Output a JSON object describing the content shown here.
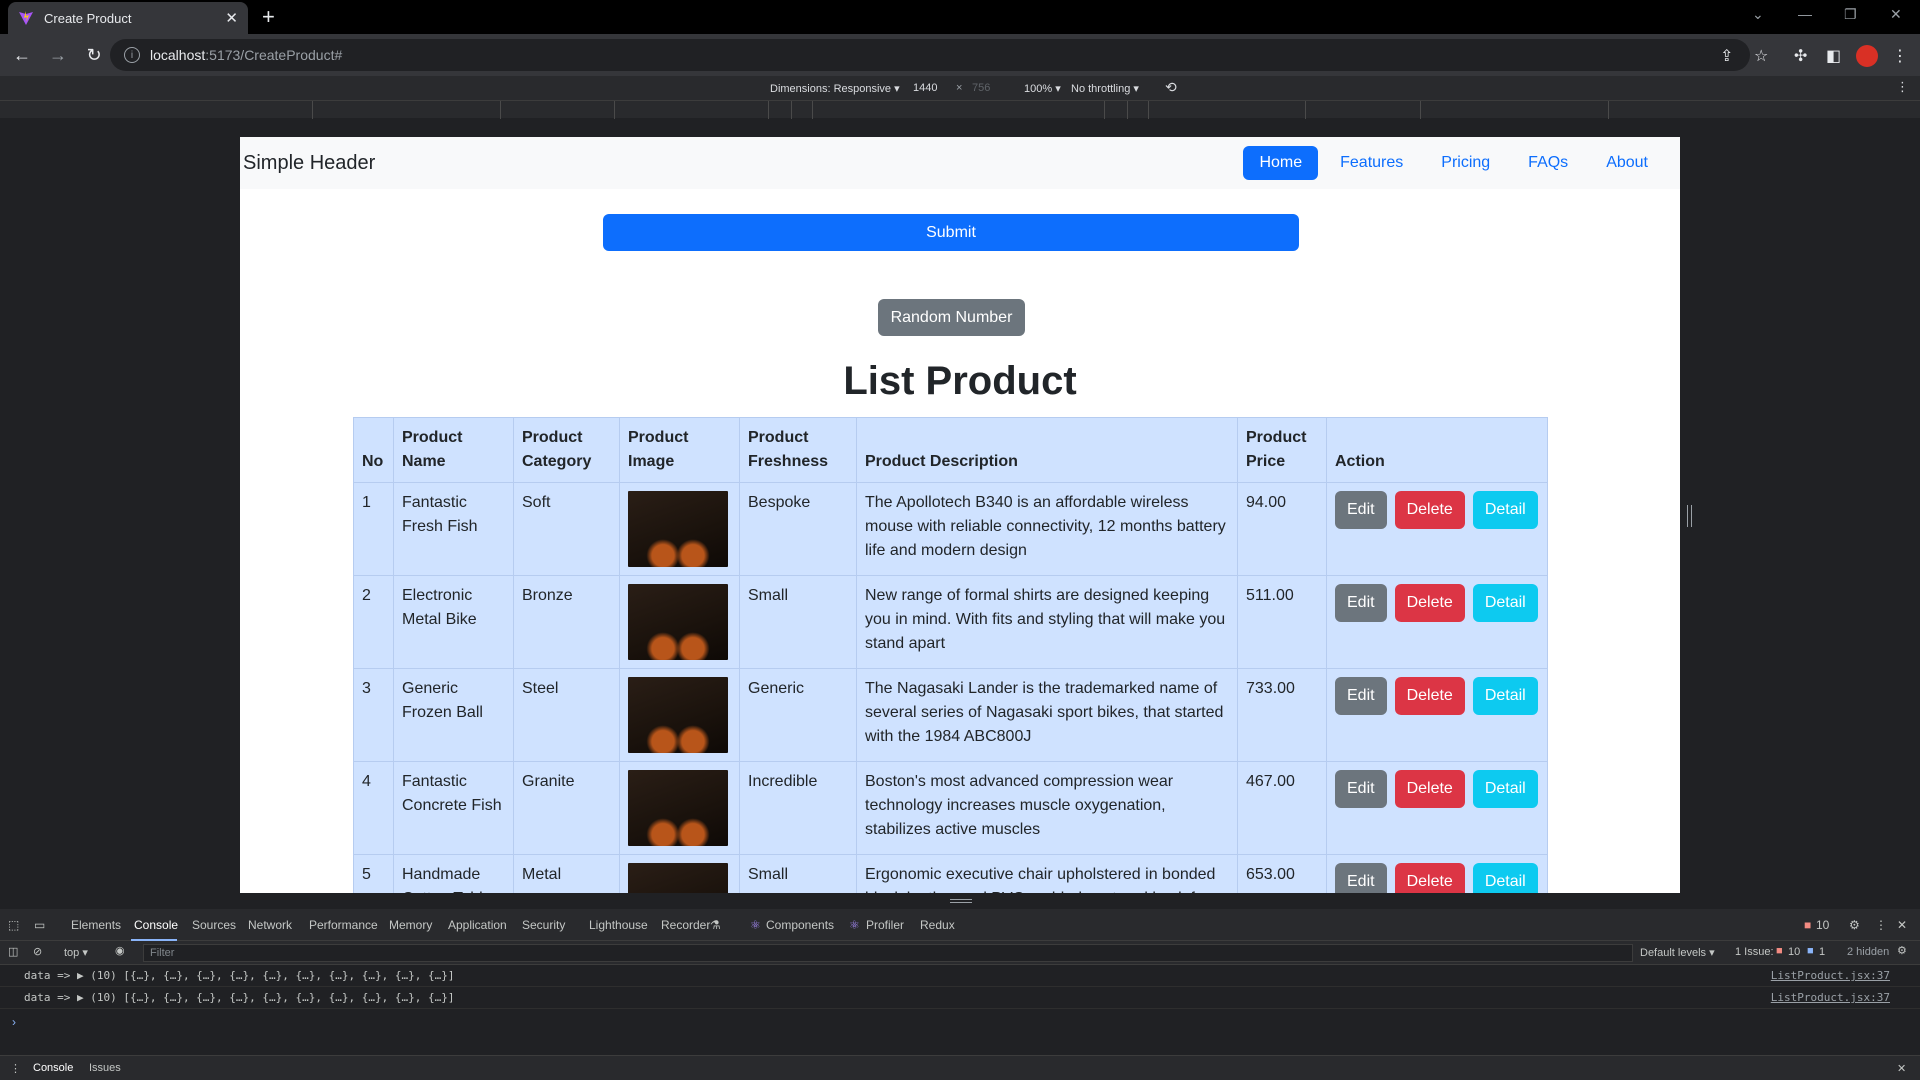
{
  "browser": {
    "tab_title": "Create Product",
    "url_host": "localhost",
    "url_path": ":5173/CreateProduct#"
  },
  "devbar": {
    "dimensions": "Dimensions: Responsive ▾",
    "width": "1440",
    "times": "×",
    "height": "756",
    "zoom": "100% ▾",
    "throttling": "No throttling ▾"
  },
  "header": {
    "brand": "Simple Header",
    "nav": [
      "Home",
      "Features",
      "Pricing",
      "FAQs",
      "About"
    ]
  },
  "buttons": {
    "submit": "Submit",
    "random": "Random Number"
  },
  "list": {
    "title": "List Product",
    "columns": [
      "No",
      "Product Name",
      "Product Category",
      "Product Image",
      "Product Freshness",
      "Product Description",
      "Product Price",
      "Action"
    ],
    "rows": [
      {
        "no": "1",
        "name": "Fantastic Fresh Fish",
        "category": "Soft",
        "freshness": "Bespoke",
        "description": "The Apollotech B340 is an affordable wireless mouse with reliable connectivity, 12 months battery life and modern design",
        "price": "94.00"
      },
      {
        "no": "2",
        "name": "Electronic Metal Bike",
        "category": "Bronze",
        "freshness": "Small",
        "description": "New range of formal shirts are designed keeping you in mind. With fits and styling that will make you stand apart",
        "price": "511.00"
      },
      {
        "no": "3",
        "name": "Generic Frozen Ball",
        "category": "Steel",
        "freshness": "Generic",
        "description": "The Nagasaki Lander is the trademarked name of several series of Nagasaki sport bikes, that started with the 1984 ABC800J",
        "price": "733.00"
      },
      {
        "no": "4",
        "name": "Fantastic Concrete Fish",
        "category": "Granite",
        "freshness": "Incredible",
        "description": "Boston's most advanced compression wear technology increases muscle oxygenation, stabilizes active muscles",
        "price": "467.00"
      },
      {
        "no": "5",
        "name": "Handmade Cotton Table",
        "category": "Metal",
        "freshness": "Small",
        "description": "Ergonomic executive chair upholstered in bonded black leather and PVC padded seat and back for all-day comfort and support",
        "price": "653.00"
      }
    ],
    "actions": {
      "edit": "Edit",
      "delete": "Delete",
      "detail": "Detail"
    }
  },
  "devtools": {
    "tabs": [
      "Elements",
      "Console",
      "Sources",
      "Network",
      "Performance",
      "Memory",
      "Application",
      "Security",
      "Lighthouse",
      "Recorder",
      "Components",
      "Profiler",
      "Redux"
    ],
    "error_count": "10",
    "context": "top ▾",
    "filter_placeholder": "Filter",
    "levels": "Default levels ▾",
    "issues": "1 Issue:",
    "issue_errors": "10",
    "issue_info": "1",
    "hidden": "2 hidden",
    "console_lines": [
      {
        "text": "data =>  ▶ (10) [{…}, {…}, {…}, {…}, {…}, {…}, {…}, {…}, {…}, {…}]",
        "source": "ListProduct.jsx:37"
      },
      {
        "text": "data =>  ▶ (10) [{…}, {…}, {…}, {…}, {…}, {…}, {…}, {…}, {…}, {…}]",
        "source": "ListProduct.jsx:37"
      }
    ],
    "drawer_tabs": [
      "Console",
      "Issues"
    ]
  },
  "colors": {
    "primary": "#0d6efd",
    "secondary": "#6c757d",
    "danger": "#dc3545",
    "info": "#0dcaf0",
    "table_bg": "#cfe2ff"
  }
}
